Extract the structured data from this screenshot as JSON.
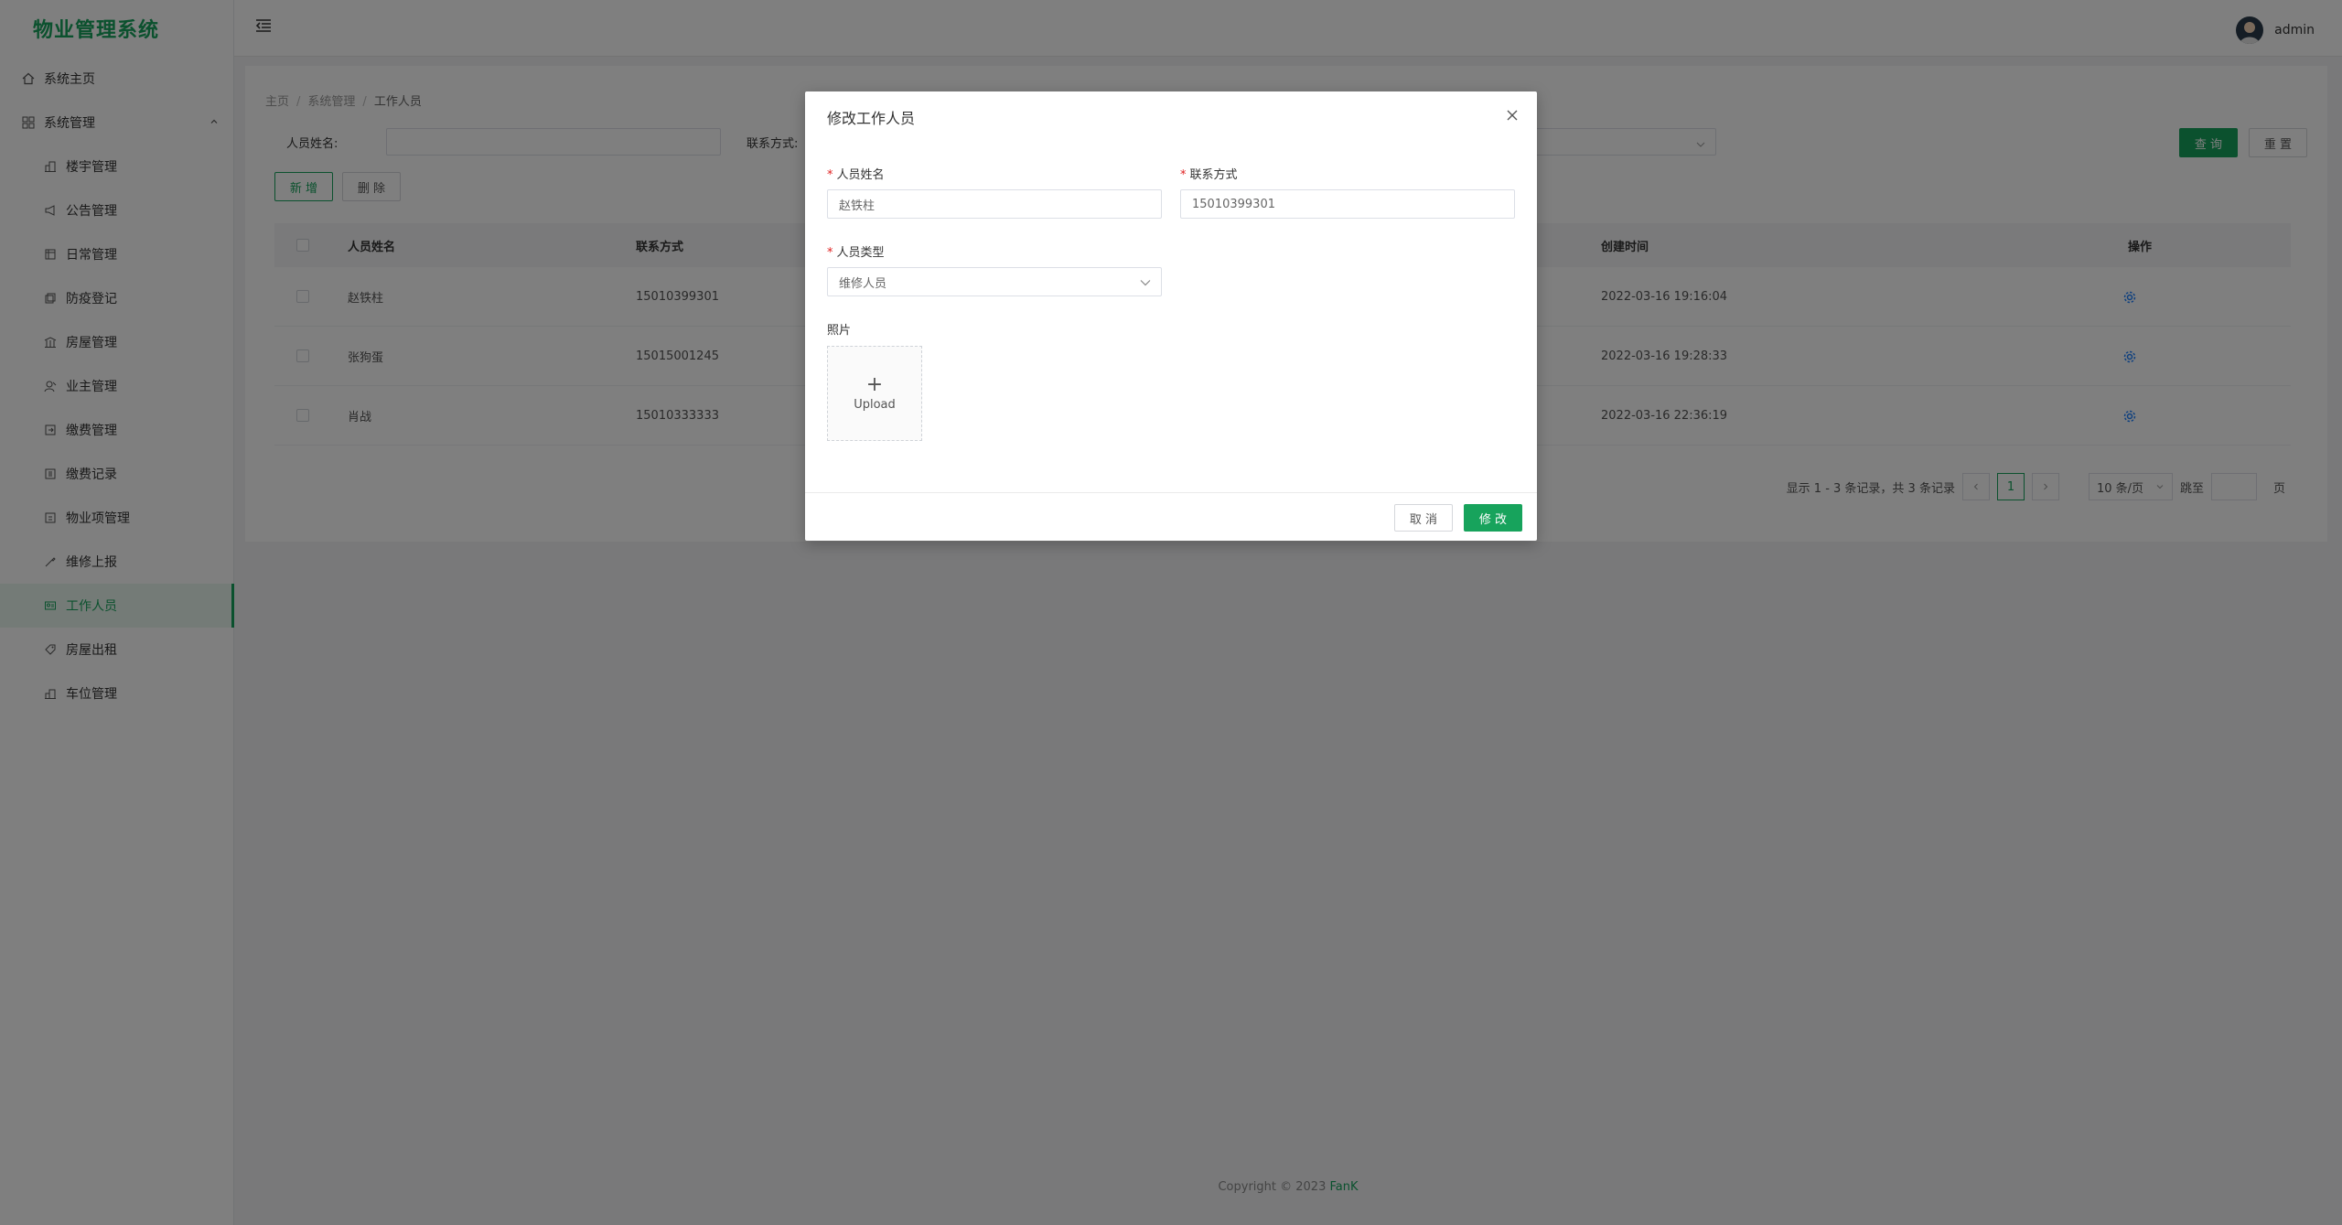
{
  "app": {
    "title": "物业管理系统"
  },
  "colors": {
    "accent": "#17a35c",
    "overlay": "rgba(0,0,0,0.5)",
    "link": "#1e80ff"
  },
  "sidebar": {
    "items": [
      {
        "label": "系统主页",
        "icon": "home-icon"
      },
      {
        "label": "系统管理",
        "icon": "grid-icon",
        "expanded": true
      }
    ],
    "sub_items": [
      {
        "label": "楼宇管理",
        "icon": "building-icon"
      },
      {
        "label": "公告管理",
        "icon": "megaphone-icon"
      },
      {
        "label": "日常管理",
        "icon": "calendar-icon"
      },
      {
        "label": "防疫登记",
        "icon": "shield-icon"
      },
      {
        "label": "房屋管理",
        "icon": "house-icon"
      },
      {
        "label": "业主管理",
        "icon": "user-icon"
      },
      {
        "label": "缴费管理",
        "icon": "payment-icon"
      },
      {
        "label": "缴费记录",
        "icon": "record-icon"
      },
      {
        "label": "物业项管理",
        "icon": "list-icon"
      },
      {
        "label": "维修上报",
        "icon": "wrench-icon"
      },
      {
        "label": "工作人员",
        "icon": "id-card-icon",
        "active": true
      },
      {
        "label": "房屋出租",
        "icon": "tag-icon"
      },
      {
        "label": "车位管理",
        "icon": "parking-icon"
      }
    ]
  },
  "header": {
    "username": "admin"
  },
  "breadcrumb": [
    "主页",
    "系统管理",
    "工作人员"
  ],
  "search": {
    "name_label": "人员姓名:",
    "phone_label": "联系方式:",
    "query_button": "查 询",
    "reset_button": "重 置"
  },
  "toolbar": {
    "add_button": "新 增",
    "delete_button": "删 除"
  },
  "table": {
    "columns": [
      "人员姓名",
      "联系方式",
      "创建时间",
      "操作"
    ],
    "rows": [
      {
        "name": "赵铁柱",
        "phone": "15010399301",
        "created": "2022-03-16 19:16:04"
      },
      {
        "name": "张狗蛋",
        "phone": "15015001245",
        "created": "2022-03-16 19:28:33"
      },
      {
        "name": "肖战",
        "phone": "15010333333",
        "created": "2022-03-16 22:36:19"
      }
    ]
  },
  "pagination": {
    "summary": "显示 1 - 3 条记录，共 3 条记录",
    "current_page": "1",
    "page_size": "10 条/页",
    "jump_label": "跳至",
    "page_suffix": "页"
  },
  "footer": {
    "text": "Copyright © 2023 ",
    "brand": "FanK"
  },
  "modal": {
    "title": "修改工作人员",
    "name_label": "人员姓名",
    "name_value": "赵铁柱",
    "phone_label": "联系方式",
    "phone_value": "15010399301",
    "type_label": "人员类型",
    "type_value": "维修人员",
    "photo_label": "照片",
    "upload_label": "Upload",
    "cancel_button": "取 消",
    "submit_button": "修 改"
  }
}
